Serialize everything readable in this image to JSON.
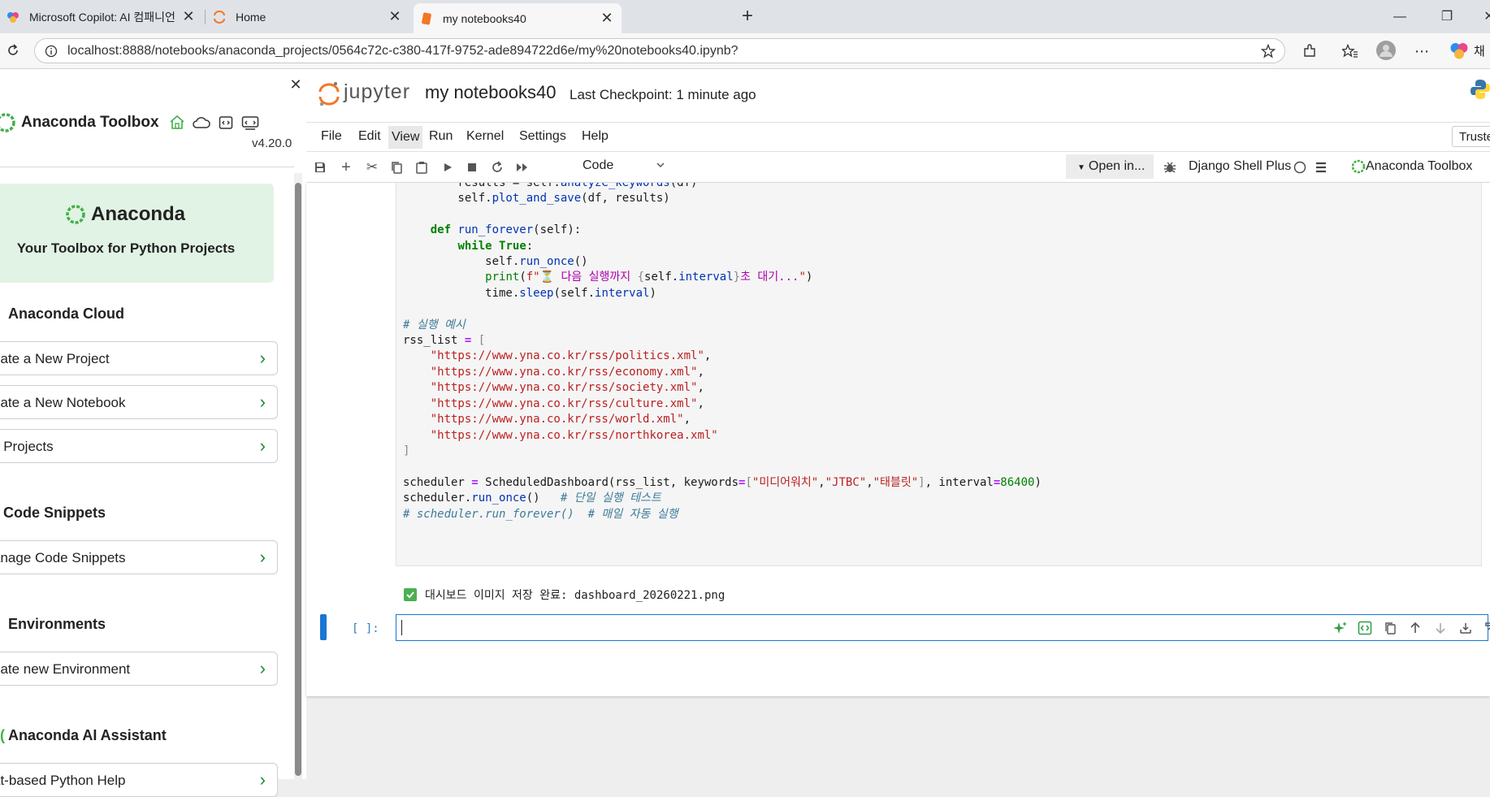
{
  "browser": {
    "tabs": [
      {
        "title": "Microsoft Copilot: AI 컴패니언"
      },
      {
        "title": "Home"
      },
      {
        "title": "my notebooks40"
      }
    ],
    "url": "localhost:8888/notebooks/anaconda_projects/0564c72c-c380-417f-9752-ade894722d6e/my%20notebooks40.ipynb?",
    "profile_label": "채"
  },
  "toolbox": {
    "title": "Anaconda Toolbox",
    "version": "v4.20.0",
    "hero_name": "Anaconda",
    "hero_tagline": "Your Toolbox for Python Projects",
    "sections": {
      "cloud": "Anaconda Cloud",
      "snippets": "Code Snippets",
      "environments": "Environments",
      "assistant": "Anaconda AI Assistant"
    },
    "actions": {
      "new_project": "eate a New Project",
      "new_notebook": "eate a New Notebook",
      "my_projects": "y Projects",
      "manage_snippets": "anage Code Snippets",
      "new_env": "eate new Environment",
      "chat_help": "at-based Python Help"
    }
  },
  "jupyter": {
    "logo_text": "jupyter",
    "notebook_title": "my notebooks40",
    "checkpoint": "Last Checkpoint: 1 minute ago",
    "menus": [
      "File",
      "Edit",
      "View",
      "Run",
      "Kernel",
      "Settings",
      "Help"
    ],
    "trusted": "Truste",
    "cell_type": "Code",
    "open_in": "Open in...",
    "kernel": "Django Shell Plus",
    "toolbox_button": "Anaconda Toolbox",
    "output_text": "대시보드 이미지 저장 완료: dashboard_20260221.png",
    "empty_prompt": "[ ]:"
  },
  "colors": {
    "anaconda_green": "#43b049",
    "jupyter_orange": "#f37626",
    "cell_blue": "#1976d2"
  }
}
